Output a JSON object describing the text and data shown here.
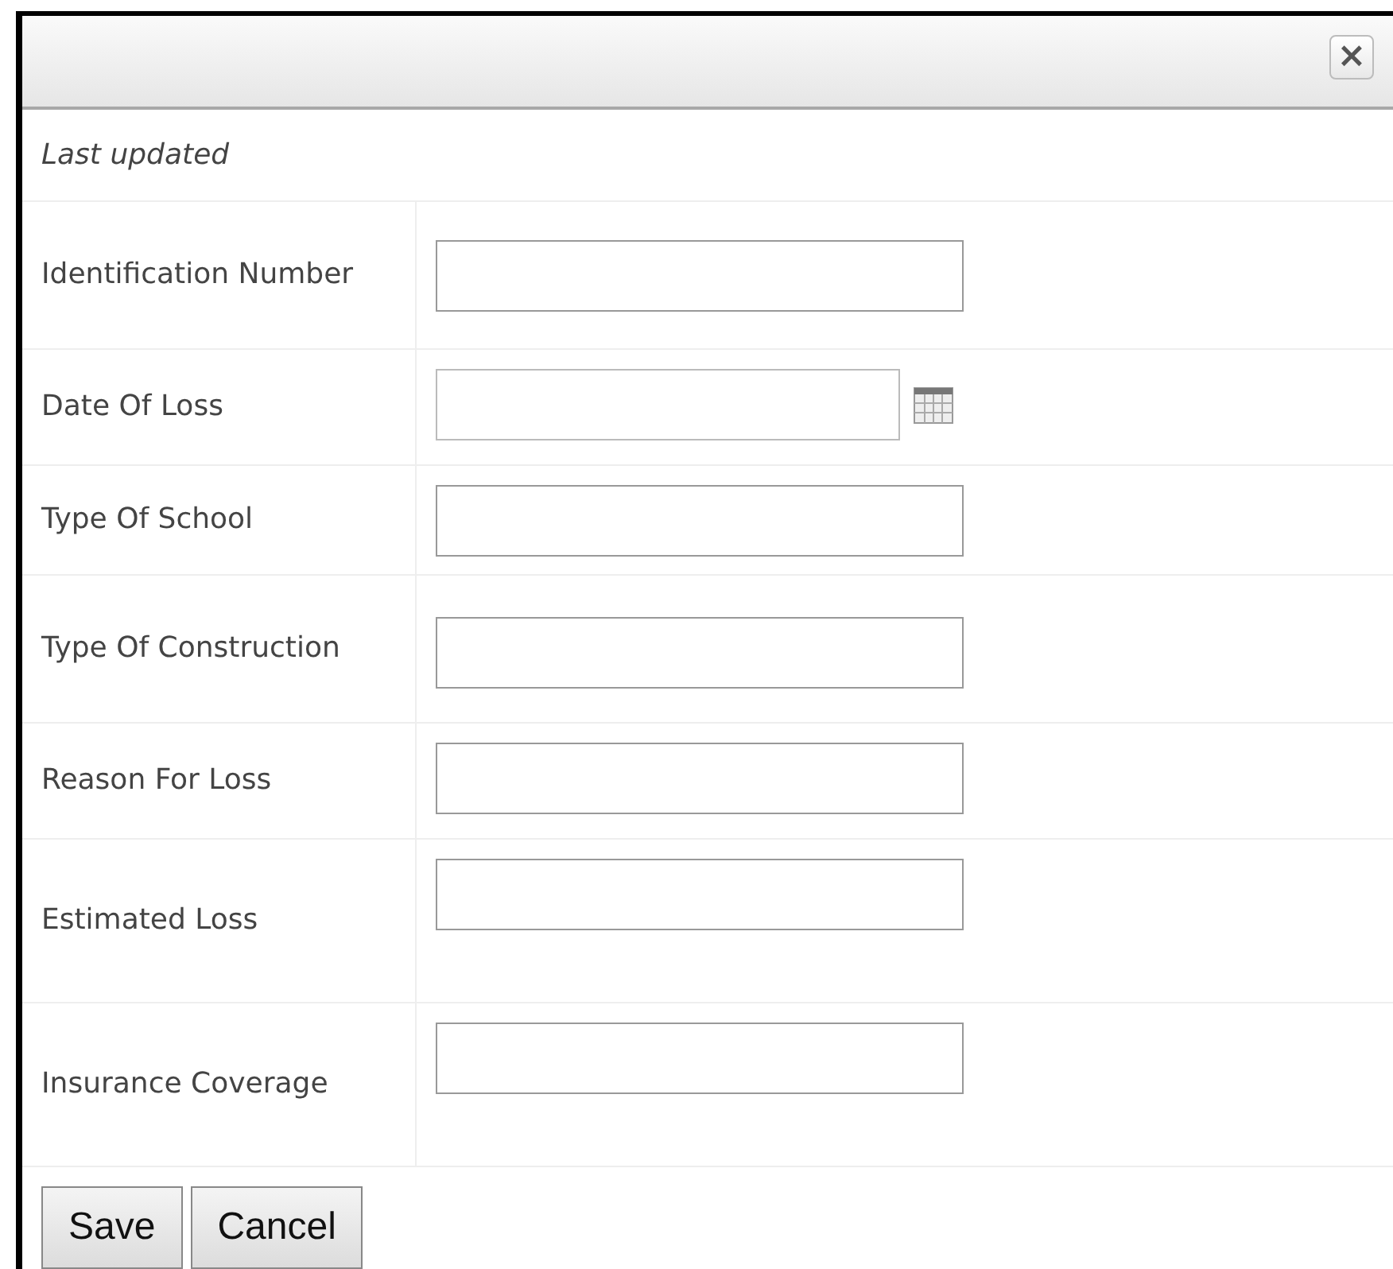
{
  "dialog": {
    "close_label": "×",
    "last_updated": "Last updated",
    "fields": [
      {
        "label": "Identification Number",
        "kind": "text"
      },
      {
        "label": "Date Of Loss",
        "kind": "date"
      },
      {
        "label": "Type Of School",
        "kind": "text"
      },
      {
        "label": "Type Of Construction",
        "kind": "text"
      },
      {
        "label": "Reason For Loss",
        "kind": "text"
      },
      {
        "label": "Estimated Loss",
        "kind": "text"
      },
      {
        "label": "Insurance Coverage",
        "kind": "text"
      }
    ],
    "buttons": [
      "Save",
      "Cancel"
    ]
  }
}
